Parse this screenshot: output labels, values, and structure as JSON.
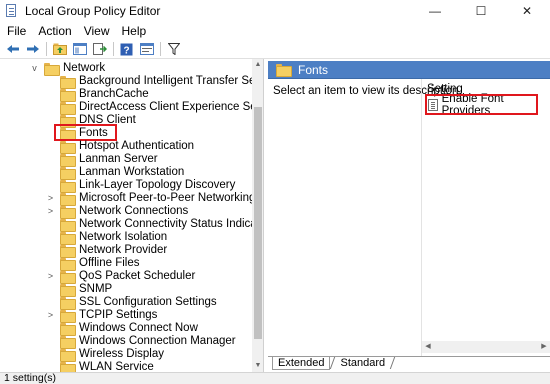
{
  "window": {
    "title": "Local Group Policy Editor",
    "minimize": "—",
    "maximize": "☐",
    "close": "✕"
  },
  "menu": [
    "File",
    "Action",
    "View",
    "Help"
  ],
  "toolbar": {
    "icons": [
      "back-arrow-icon",
      "forward-arrow-icon",
      "up-folder-icon",
      "show-hide-tree-icon",
      "export-list-icon",
      "help-icon",
      "properties-icon",
      "filter-icon"
    ]
  },
  "tree": {
    "items": [
      {
        "label": "Network",
        "expander": "v"
      },
      {
        "label": "Background Intelligent Transfer Service (BITS)",
        "expander": ""
      },
      {
        "label": "BranchCache",
        "expander": ""
      },
      {
        "label": "DirectAccess Client Experience Settings",
        "expander": ""
      },
      {
        "label": "DNS Client",
        "expander": ""
      },
      {
        "label": "Fonts",
        "expander": ""
      },
      {
        "label": "Hotspot Authentication",
        "expander": ""
      },
      {
        "label": "Lanman Server",
        "expander": ""
      },
      {
        "label": "Lanman Workstation",
        "expander": ""
      },
      {
        "label": "Link-Layer Topology Discovery",
        "expander": ""
      },
      {
        "label": "Microsoft Peer-to-Peer Networking Services",
        "expander": ">"
      },
      {
        "label": "Network Connections",
        "expander": ">"
      },
      {
        "label": "Network Connectivity Status Indicator",
        "expander": ""
      },
      {
        "label": "Network Isolation",
        "expander": ""
      },
      {
        "label": "Network Provider",
        "expander": ""
      },
      {
        "label": "Offline Files",
        "expander": ""
      },
      {
        "label": "QoS Packet Scheduler",
        "expander": ">"
      },
      {
        "label": "SNMP",
        "expander": ""
      },
      {
        "label": "SSL Configuration Settings",
        "expander": ""
      },
      {
        "label": "TCPIP Settings",
        "expander": ">"
      },
      {
        "label": "Windows Connect Now",
        "expander": ""
      },
      {
        "label": "Windows Connection Manager",
        "expander": ""
      },
      {
        "label": "Wireless Display",
        "expander": ""
      },
      {
        "label": "WLAN Service",
        "expander": ""
      }
    ]
  },
  "details": {
    "header_title": "Fonts",
    "description": "Select an item to view its description.",
    "column_header": "Setting",
    "settings": [
      "Enable Font Providers"
    ]
  },
  "tabs": [
    "Extended",
    "Standard"
  ],
  "status": "1 setting(s)"
}
